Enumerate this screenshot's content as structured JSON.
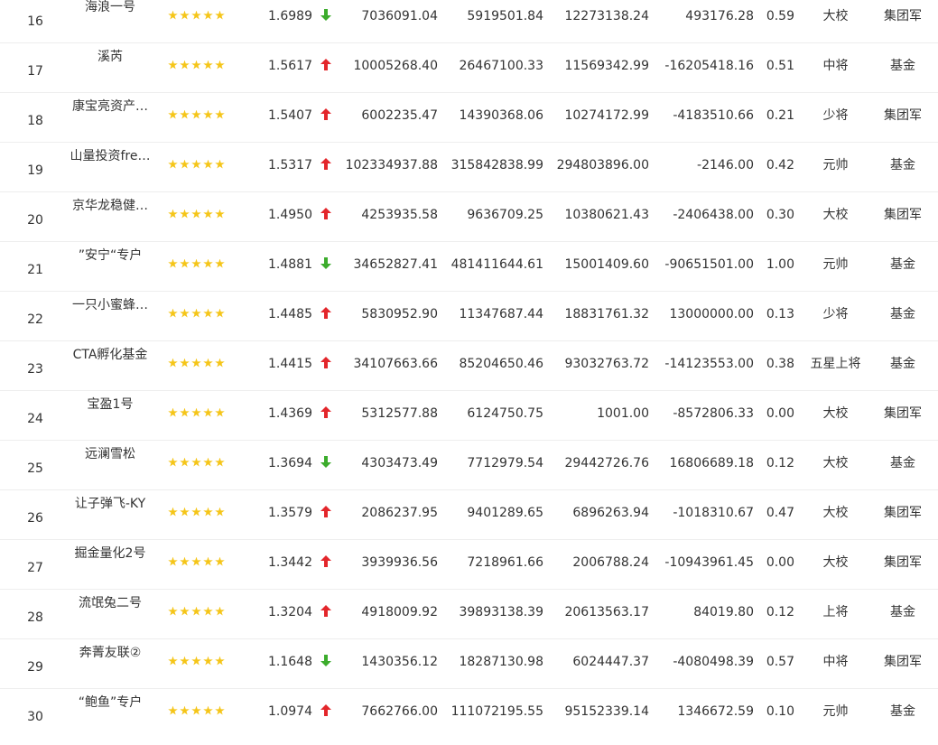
{
  "colors": {
    "up": "#e3262b",
    "down": "#3cac2c",
    "star": "#f5c518",
    "text": "#333333",
    "divider": "#eeeeee"
  },
  "icons": {
    "up": "arrow-up-icon",
    "down": "arrow-down-icon",
    "star": "star-icon"
  },
  "rows": [
    {
      "rank": "16",
      "name": "海浪一号",
      "stars": 5,
      "nav": "1.6989",
      "trend": "down",
      "v1": "7036091.04",
      "v2": "5919501.84",
      "v3": "12273138.24",
      "v4": "493176.28",
      "ratio": "0.59",
      "level": "大校",
      "type": "集团军"
    },
    {
      "rank": "17",
      "name": "溪芮",
      "stars": 5,
      "nav": "1.5617",
      "trend": "up",
      "v1": "10005268.40",
      "v2": "26467100.33",
      "v3": "11569342.99",
      "v4": "-16205418.16",
      "ratio": "0.51",
      "level": "中将",
      "type": "基金"
    },
    {
      "rank": "18",
      "name": "康宝亮资产…",
      "stars": 5,
      "nav": "1.5407",
      "trend": "up",
      "v1": "6002235.47",
      "v2": "14390368.06",
      "v3": "10274172.99",
      "v4": "-4183510.66",
      "ratio": "0.21",
      "level": "少将",
      "type": "集团军"
    },
    {
      "rank": "19",
      "name": "山量投资fre…",
      "stars": 5,
      "nav": "1.5317",
      "trend": "up",
      "v1": "102334937.88",
      "v2": "315842838.99",
      "v3": "294803896.00",
      "v4": "-2146.00",
      "ratio": "0.42",
      "level": "元帅",
      "type": "基金"
    },
    {
      "rank": "20",
      "name": "京华龙稳健…",
      "stars": 5,
      "nav": "1.4950",
      "trend": "up",
      "v1": "4253935.58",
      "v2": "9636709.25",
      "v3": "10380621.43",
      "v4": "-2406438.00",
      "ratio": "0.30",
      "level": "大校",
      "type": "集团军"
    },
    {
      "rank": "21",
      "name": "”安宁“专户",
      "stars": 5,
      "nav": "1.4881",
      "trend": "down",
      "v1": "34652827.41",
      "v2": "481411644.61",
      "v3": "15001409.60",
      "v4": "-90651501.00",
      "ratio": "1.00",
      "level": "元帅",
      "type": "基金"
    },
    {
      "rank": "22",
      "name": "一只小蜜蜂…",
      "stars": 5,
      "nav": "1.4485",
      "trend": "up",
      "v1": "5830952.90",
      "v2": "11347687.44",
      "v3": "18831761.32",
      "v4": "13000000.00",
      "ratio": "0.13",
      "level": "少将",
      "type": "基金"
    },
    {
      "rank": "23",
      "name": "CTA孵化基金",
      "stars": 5,
      "nav": "1.4415",
      "trend": "up",
      "v1": "34107663.66",
      "v2": "85204650.46",
      "v3": "93032763.72",
      "v4": "-14123553.00",
      "ratio": "0.38",
      "level": "五星上将",
      "type": "基金"
    },
    {
      "rank": "24",
      "name": "宝盈1号",
      "stars": 5,
      "nav": "1.4369",
      "trend": "up",
      "v1": "5312577.88",
      "v2": "6124750.75",
      "v3": "1001.00",
      "v4": "-8572806.33",
      "ratio": "0.00",
      "level": "大校",
      "type": "集团军"
    },
    {
      "rank": "25",
      "name": "远澜雪松",
      "stars": 5,
      "nav": "1.3694",
      "trend": "down",
      "v1": "4303473.49",
      "v2": "7712979.54",
      "v3": "29442726.76",
      "v4": "16806689.18",
      "ratio": "0.12",
      "level": "大校",
      "type": "基金"
    },
    {
      "rank": "26",
      "name": "让子弹飞-KY",
      "stars": 5,
      "nav": "1.3579",
      "trend": "up",
      "v1": "2086237.95",
      "v2": "9401289.65",
      "v3": "6896263.94",
      "v4": "-1018310.67",
      "ratio": "0.47",
      "level": "大校",
      "type": "集团军"
    },
    {
      "rank": "27",
      "name": "掘金量化2号",
      "stars": 5,
      "nav": "1.3442",
      "trend": "up",
      "v1": "3939936.56",
      "v2": "7218961.66",
      "v3": "2006788.24",
      "v4": "-10943961.45",
      "ratio": "0.00",
      "level": "大校",
      "type": "集团军"
    },
    {
      "rank": "28",
      "name": "流氓兔二号",
      "stars": 5,
      "nav": "1.3204",
      "trend": "up",
      "v1": "4918009.92",
      "v2": "39893138.39",
      "v3": "20613563.17",
      "v4": "84019.80",
      "ratio": "0.12",
      "level": "上将",
      "type": "基金"
    },
    {
      "rank": "29",
      "name": "奔菁友联②",
      "stars": 5,
      "nav": "1.1648",
      "trend": "down",
      "v1": "1430356.12",
      "v2": "18287130.98",
      "v3": "6024447.37",
      "v4": "-4080498.39",
      "ratio": "0.57",
      "level": "中将",
      "type": "集团军"
    },
    {
      "rank": "30",
      "name": "“鲍鱼”专户",
      "stars": 5,
      "nav": "1.0974",
      "trend": "up",
      "v1": "7662766.00",
      "v2": "111072195.55",
      "v3": "95152339.14",
      "v4": "1346672.59",
      "ratio": "0.10",
      "level": "元帅",
      "type": "基金"
    }
  ]
}
